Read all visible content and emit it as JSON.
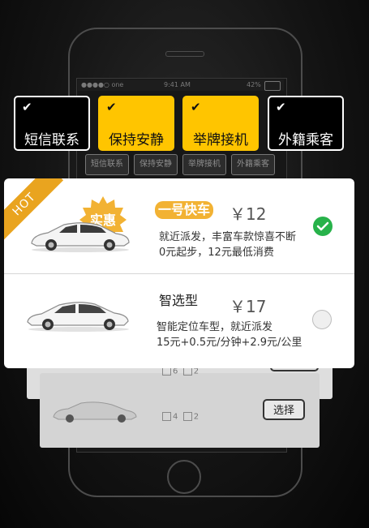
{
  "status_bar": {
    "signal": "●●●●○ one",
    "time": "9:41 AM",
    "battery": "42%"
  },
  "service_options": [
    {
      "label": "短信联系",
      "checked": true,
      "active": false
    },
    {
      "label": "保持安静",
      "checked": true,
      "active": true
    },
    {
      "label": "举牌接机",
      "checked": true,
      "active": true
    },
    {
      "label": "外籍乘客",
      "checked": true,
      "active": false
    }
  ],
  "colors": {
    "accent": "#ffc500",
    "badge": "#f2b233",
    "selected": "#27b24a",
    "ribbon": "#e9a41f"
  },
  "cars": [
    {
      "ribbon": "HOT",
      "promo": "实惠",
      "name": "一号快车",
      "price": "￥12",
      "desc1": "就近派发，丰富车款惊喜不断",
      "desc2": "0元起步，12元最低消费",
      "selected": true,
      "check_icon": "check-circle-icon"
    },
    {
      "name": "智选型",
      "price": "￥17",
      "desc1": "智能定位车型，就近派发",
      "desc2": "15元+0.5元/分钟+2.9元/公里",
      "selected": false
    }
  ],
  "background_list": {
    "row1": {
      "seats": "6",
      "luggage": "2"
    },
    "row2": {
      "seats": "4",
      "luggage": "2",
      "button": "选择"
    }
  }
}
